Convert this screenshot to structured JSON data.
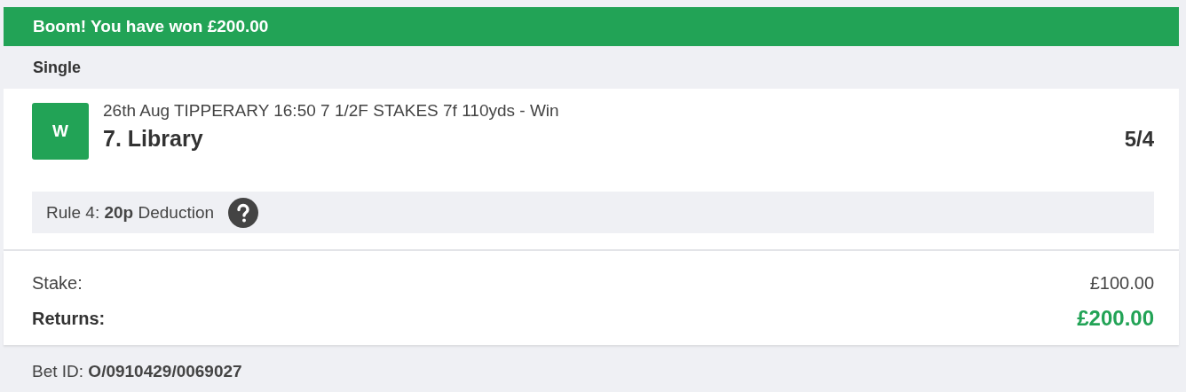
{
  "banner": {
    "title": "Boom! You have won £200.00"
  },
  "bet_type": "Single",
  "selection": {
    "result": "W",
    "event": "26th Aug TIPPERARY 16:50 7 1/2F STAKES 7f 110yds - Win",
    "name": "7. Library",
    "odds": "5/4",
    "rule4": "Rule 4: **20p** Deduction"
  },
  "summary": [
    {
      "label": "Stake:",
      "value": "£100.00",
      "kind": "plain"
    },
    {
      "label": "Returns:",
      "value": "£200.00",
      "kind": "returns"
    }
  ],
  "bet_id": "Bet ID: **O/0910429/0069027**"
}
